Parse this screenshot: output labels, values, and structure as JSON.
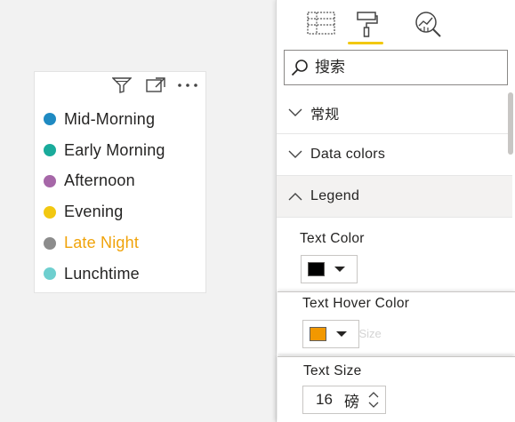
{
  "visual": {
    "header_icons": [
      "filter-icon",
      "focus-mode-icon",
      "more-options-icon"
    ],
    "legend_items": [
      {
        "label": "Mid-Morning",
        "dot_color": "#1f8ac2",
        "text_color": "#252423"
      },
      {
        "label": "Early Morning",
        "dot_color": "#1aab9b",
        "text_color": "#252423"
      },
      {
        "label": "Afternoon",
        "dot_color": "#a667a8",
        "text_color": "#252423"
      },
      {
        "label": "Evening",
        "dot_color": "#f2c811",
        "text_color": "#252423"
      },
      {
        "label": "Late Night",
        "dot_color": "#8c8c8c",
        "text_color": "#f0a30a"
      },
      {
        "label": "Lunchtime",
        "dot_color": "#6ecfcf",
        "text_color": "#252423"
      }
    ]
  },
  "pane": {
    "tabs": [
      {
        "icon": "fields-icon",
        "active": false
      },
      {
        "icon": "format-paint-roller-icon",
        "active": true
      },
      {
        "icon": "analytics-icon",
        "active": false
      }
    ],
    "search": {
      "placeholder": "搜索",
      "value": ""
    },
    "sections": [
      {
        "label": "常规",
        "expanded": false
      },
      {
        "label": "Data colors",
        "expanded": false
      },
      {
        "label": "Legend",
        "expanded": true
      }
    ],
    "text_color": {
      "label": "Text Color",
      "color": "#000000"
    },
    "text_hover_color": {
      "label": "Text Hover Color",
      "color": "#f29800"
    },
    "ghost_label": "Text Size",
    "text_size": {
      "label": "Text Size",
      "value": "16",
      "unit": "磅"
    }
  }
}
